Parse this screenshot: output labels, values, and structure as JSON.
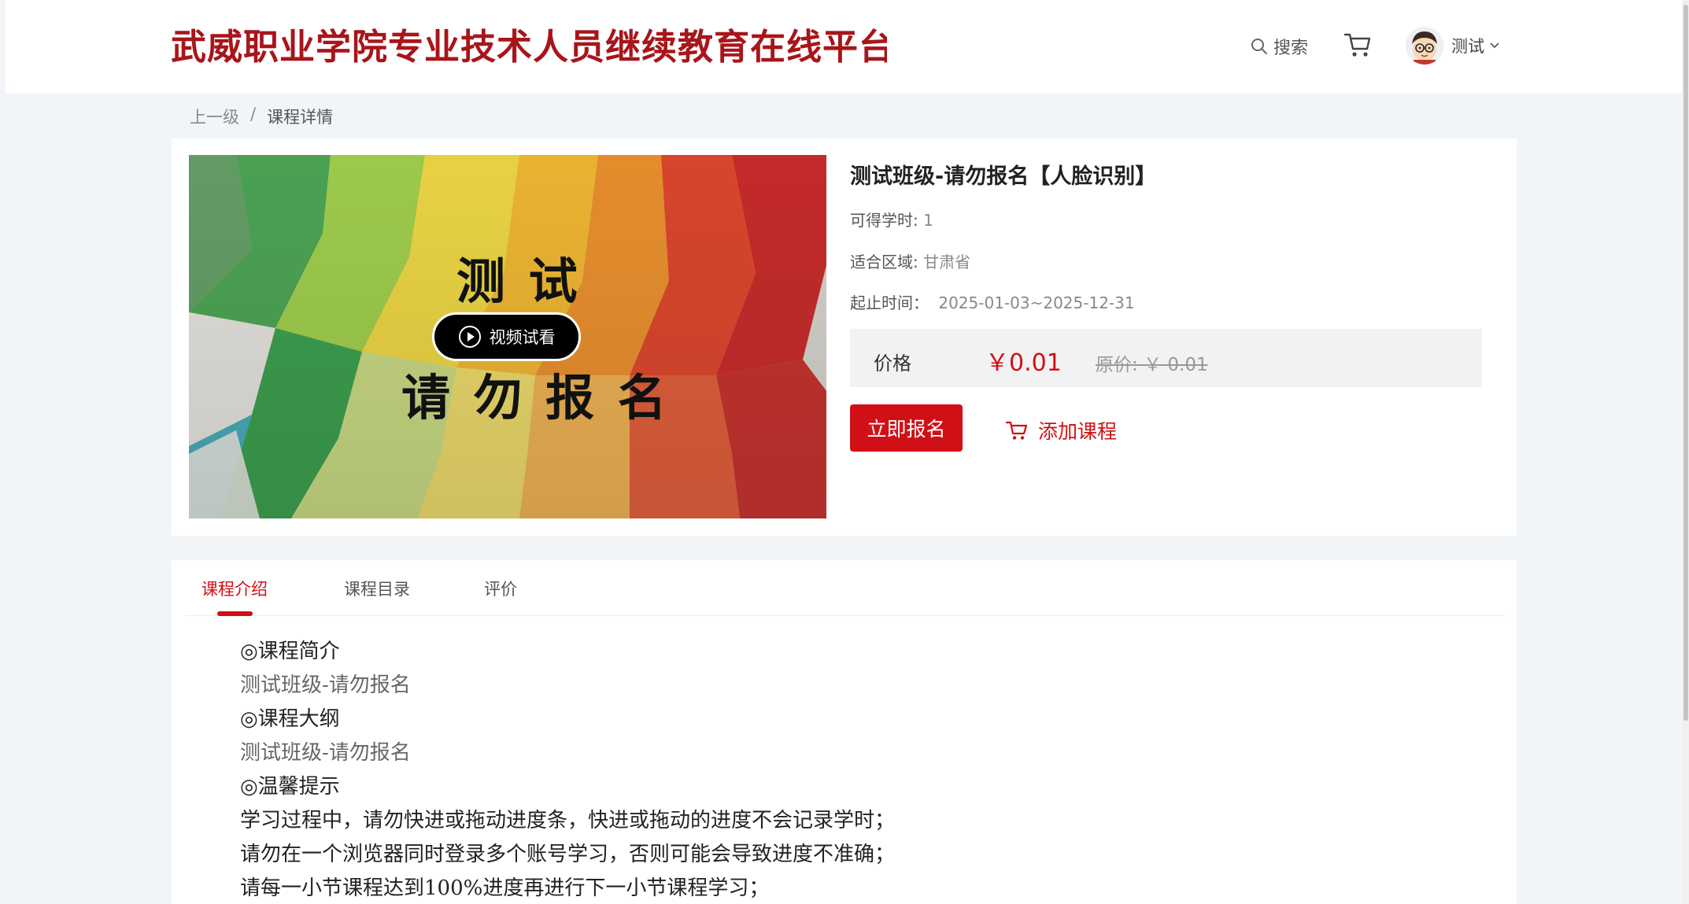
{
  "header": {
    "site_title": "武威职业学院专业技术人员继续教育在线平台",
    "search_label": "搜索",
    "user_name": "测试"
  },
  "breadcrumb": {
    "parent": "上一级",
    "separator": "/",
    "current": "课程详情"
  },
  "course": {
    "title": "测试班级-请勿报名【人脸识别】",
    "hours_label": "可得学时:",
    "hours_value": "1",
    "region_label": "适合区域:",
    "region_value": "甘肃省",
    "period_label": "起止时间：",
    "period_value": "2025-01-03~2025-12-31",
    "price_label": "价格",
    "price_value": "￥0.01",
    "original_price": "原价: ￥ 0.01",
    "enroll_label": "立即报名",
    "add_course_label": "添加课程",
    "video_preview_label": "视频试看",
    "cover_text_line1": "测 试",
    "cover_text_line2": "请 勿 报 名"
  },
  "tabs": [
    {
      "label": "课程介绍",
      "active": true
    },
    {
      "label": "课程目录",
      "active": false
    },
    {
      "label": "评价",
      "active": false
    }
  ],
  "content": [
    {
      "text": "◎课程简介",
      "style": "heading"
    },
    {
      "text": "测试班级-请勿报名",
      "style": "gray"
    },
    {
      "text": "◎课程大纲",
      "style": "heading"
    },
    {
      "text": "测试班级-请勿报名",
      "style": "gray"
    },
    {
      "text": "◎温馨提示",
      "style": "heading"
    },
    {
      "text": "学习过程中，请勿快进或拖动进度条，快进或拖动的进度不会记录学时；",
      "style": "normal"
    },
    {
      "text": "请勿在一个浏览器同时登录多个账号学习，否则可能会导致进度不准确；",
      "style": "normal"
    },
    {
      "text": "请每一小节课程达到100%进度再进行下一小节课程学习；",
      "style": "normal"
    }
  ],
  "colors": {
    "brand_red": "#d01016",
    "logo_red": "#a8151a"
  },
  "icons": [
    "search-icon",
    "cart-icon",
    "avatar",
    "chevron-down-icon",
    "play-icon",
    "cart-add-icon"
  ]
}
